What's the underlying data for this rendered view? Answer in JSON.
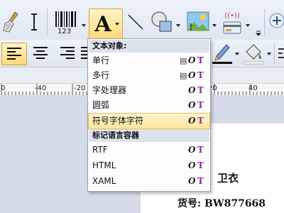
{
  "toolbar": {
    "barcode_label": "123",
    "text_glyph": "A",
    "wifi_glyph": "((•))"
  },
  "menu": {
    "sections": [
      {
        "header": "文本对象:",
        "items": [
          {
            "label": "单行",
            "printer": true
          },
          {
            "label": "多行",
            "printer": true
          },
          {
            "label": "字处理器",
            "printer": false
          },
          {
            "label": "圆弧",
            "printer": false
          },
          {
            "label": "符号字体字符",
            "printer": false,
            "highlighted": true
          }
        ]
      },
      {
        "header": "标记语言容器",
        "items": [
          {
            "label": "RTF",
            "printer": false
          },
          {
            "label": "HTML",
            "printer": false
          },
          {
            "label": "XAML",
            "printer": false
          }
        ]
      }
    ],
    "icon_o": "O",
    "icon_t": "T",
    "icon_printer": "▤"
  },
  "ruler": {
    "numbers": [
      "0",
      "-40",
      "-20",
      "0",
      "20",
      "40"
    ]
  },
  "label": {
    "title": "卫衣",
    "code": "货号: BW877668"
  },
  "colors": {
    "accent_highlight": "#ffe59a",
    "text_icon_purple": "#8a2aa0",
    "canvas_bg": "#d6dbe9"
  }
}
